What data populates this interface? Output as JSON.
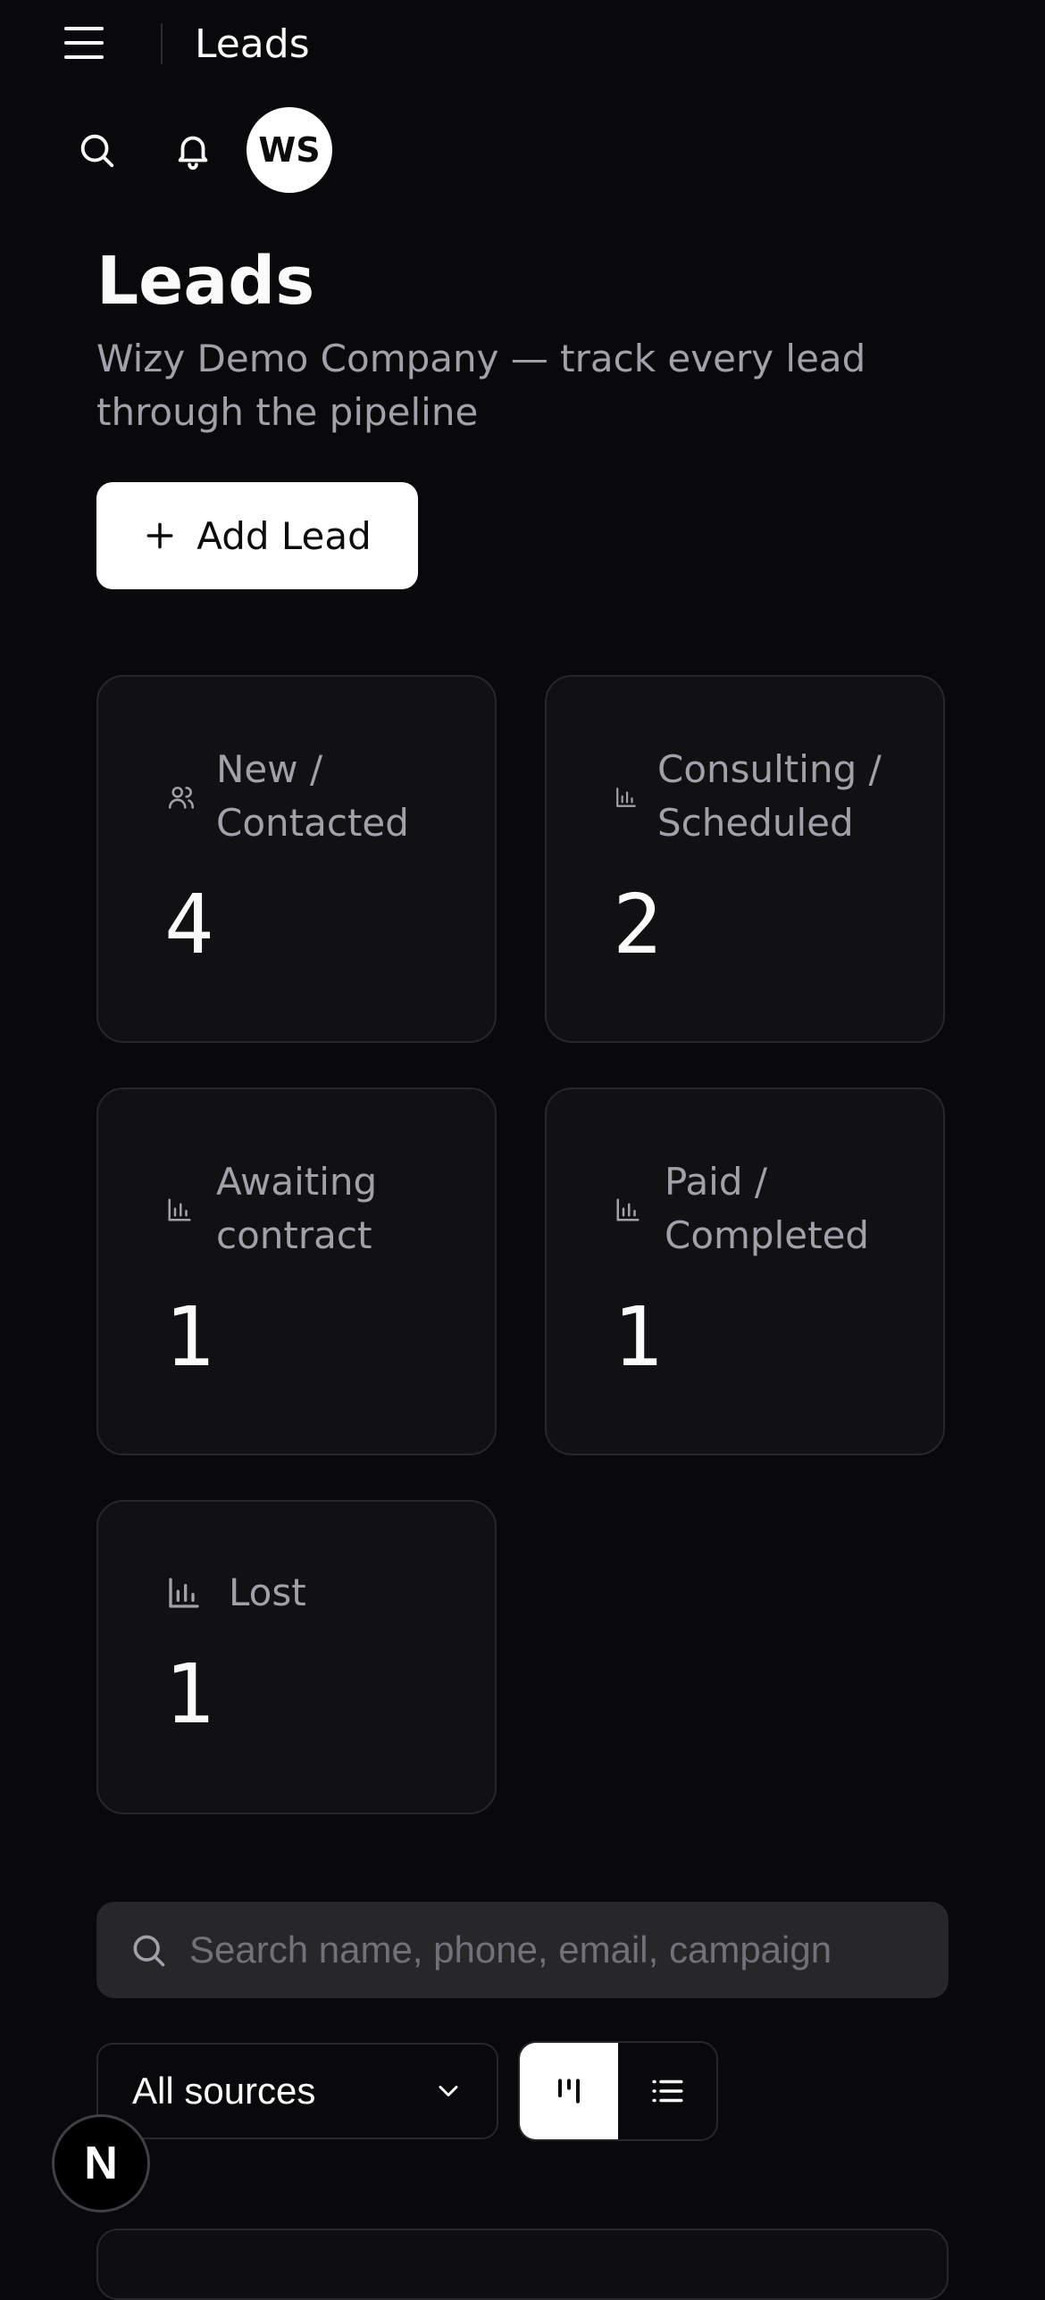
{
  "topbar": {
    "title": "Leads",
    "icons": {
      "menu": "menu-icon",
      "search": "search-icon",
      "notifications": "bell-icon"
    },
    "avatar_initials": "WS"
  },
  "header": {
    "title": "Leads",
    "subtitle": "Wizy Demo Company — track every lead through the pipeline",
    "add_button_label": "Add Lead"
  },
  "stats": [
    {
      "label": "New / Contacted",
      "value": "4",
      "icon": "users-icon"
    },
    {
      "label": "Consulting / Scheduled",
      "value": "2",
      "icon": "bar-chart-icon"
    },
    {
      "label": "Awaiting contract",
      "value": "1",
      "icon": "bar-chart-icon"
    },
    {
      "label": "Paid / Completed",
      "value": "1",
      "icon": "bar-chart-icon"
    },
    {
      "label": "Lost",
      "value": "1",
      "icon": "bar-chart-icon"
    }
  ],
  "filters": {
    "search_placeholder": "Search name, phone, email, campaign",
    "source_selected": "All sources",
    "view_modes": [
      {
        "name": "board",
        "icon": "board-view-icon",
        "active": true
      },
      {
        "name": "list",
        "icon": "list-view-icon",
        "active": false
      }
    ]
  },
  "badge": {
    "letter": "N"
  },
  "colors": {
    "background": "#09090b",
    "card": "#111113",
    "border": "#27272a",
    "muted_text": "#a1a1aa",
    "primary": "#ffffff"
  }
}
